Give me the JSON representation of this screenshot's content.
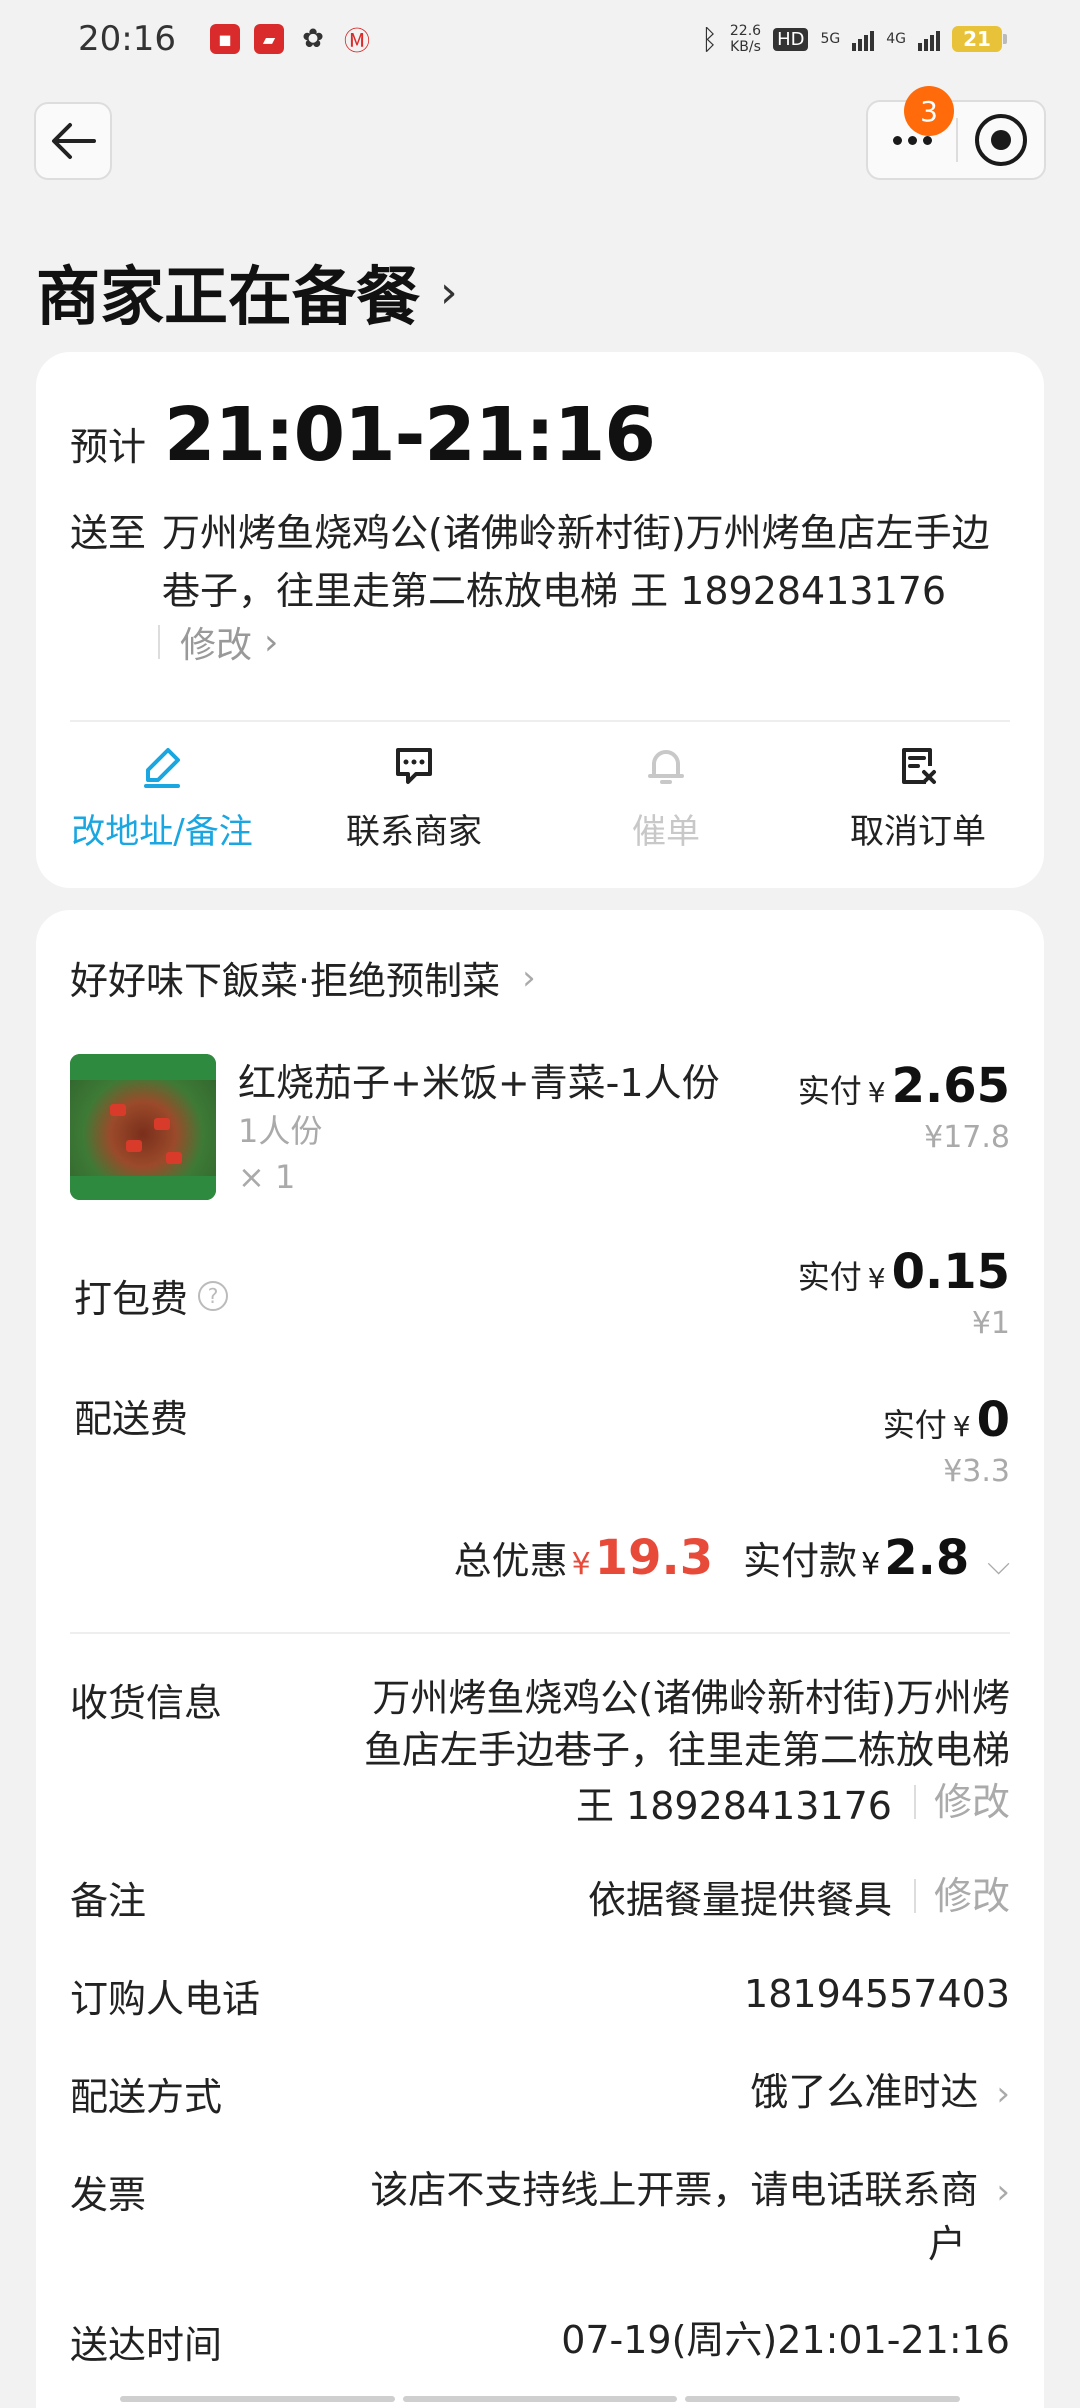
{
  "status_bar": {
    "time": "20:16",
    "net_speed_value": "22.6",
    "net_speed_unit": "KB/s",
    "hd": "HD",
    "sig1": "5G",
    "sig2": "4G",
    "battery": "21"
  },
  "header": {
    "badge_count": "3",
    "title": "商家正在备餐"
  },
  "delivery": {
    "eta_label": "预计",
    "eta_time": "21:01-21:16",
    "addr_label": "送至",
    "addr_text": "万州烤鱼烧鸡公(诸佛岭新村街)万州烤鱼店左手边巷子，往里走第二栋放电梯 王 18928413176",
    "edit_label": "修改"
  },
  "actions": [
    {
      "label": "改地址/备注",
      "icon": "edit-icon",
      "state": "active"
    },
    {
      "label": "联系商家",
      "icon": "chat-icon",
      "state": "normal"
    },
    {
      "label": "催单",
      "icon": "bell-icon",
      "state": "disabled"
    },
    {
      "label": "取消订单",
      "icon": "cancel-order-icon",
      "state": "normal"
    }
  ],
  "order": {
    "shop_name": "好好味下飯菜·拒绝预制菜",
    "item": {
      "name": "红烧茄子+米饭+青菜-1人份",
      "spec": "1人份",
      "qty": "× 1",
      "paid_label": "实付",
      "paid_yen": "¥",
      "paid": "2.65",
      "original": "¥17.8"
    },
    "packing": {
      "label": "打包费",
      "paid_label": "实付",
      "paid_yen": "¥",
      "paid": "0.15",
      "original": "¥1"
    },
    "delivery_fee": {
      "label": "配送费",
      "paid_label": "实付",
      "paid_yen": "¥",
      "paid": "0",
      "original": "¥3.3"
    },
    "summary": {
      "discount_label": "总优惠",
      "discount_yen": "¥",
      "discount": "19.3",
      "pay_label": "实付款",
      "pay_yen": "¥",
      "pay": "2.8"
    }
  },
  "info": {
    "receiver_label": "收货信息",
    "receiver_line1": "万州烤鱼烧鸡公(诸佛岭新村街)万州烤",
    "receiver_line2": "鱼店左手边巷子，往里走第二栋放电梯",
    "receiver_line3": "王 18928413176",
    "receiver_edit": "修改",
    "note_label": "备注",
    "note_value": "依据餐量提供餐具",
    "note_edit": "修改",
    "phone_label": "订购人电话",
    "phone_value": "18194557403",
    "method_label": "配送方式",
    "method_value": "饿了么准时达",
    "invoice_label": "发票",
    "invoice_line1": "该店不支持线上开票，请电话联系商",
    "invoice_line2": "户",
    "time_label": "送达时间",
    "time_value": "07-19(周六)21:01-21:16"
  },
  "colors": {
    "accent_blue": "#1aa6e0",
    "discount_red": "#e84a3a",
    "badge_orange": "#ff6a0a"
  }
}
